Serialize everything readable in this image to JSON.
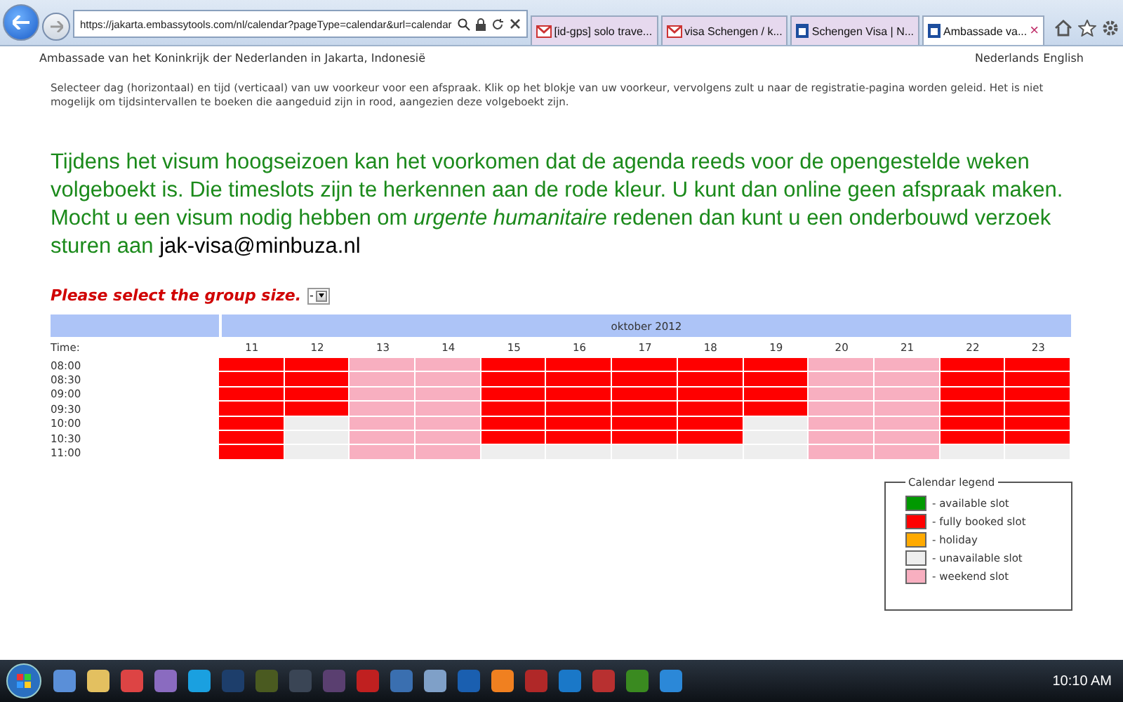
{
  "browser": {
    "address": "https://jakarta.embassytools.com/nl/calendar?pageType=calendar&url=calendar",
    "tabs": [
      {
        "title": "[id-gps] solo trave...",
        "kind": "mail",
        "selected": false
      },
      {
        "title": "visa Schengen / k...",
        "kind": "mail",
        "selected": false
      },
      {
        "title": "Schengen Visa | N...",
        "kind": "site",
        "selected": false
      },
      {
        "title": "Ambassade va...",
        "kind": "site",
        "selected": true,
        "close": "×"
      }
    ]
  },
  "header": {
    "title": "Ambassade van het Koninkrijk der Nederlanden in Jakarta, Indonesië",
    "languages": [
      "Nederlands",
      "English"
    ]
  },
  "instructions": "Selecteer dag (horizontaal) en tijd (verticaal) van uw voorkeur voor een afspraak. Klik op het blokje van uw voorkeur, vervolgens zult u naar de registratie-pagina worden geleid. Het is niet mogelijk om tijdsintervallen te boeken die aangeduid zijn in rood, aangezien deze volgeboekt zijn.",
  "notice": "Tijdens het visum hoogseizoen kan het voorkomen dat de agenda reeds voor de opengestelde weken volgeboekt is. Die timeslots zijn te herkennen aan de rode kleur. U kunt dan online geen afspraak maken. Mocht u een visum nodig hebben om *urgente humanitaire* redenen dan kunt u een onderbouwd verzoek sturen aan ",
  "notice_email": "jak-visa@minbuza.nl",
  "group_size": {
    "label": "Please select the group size.",
    "value": "-"
  },
  "calendar": {
    "month": "oktober 2012",
    "time_label": "Time:",
    "times": [
      "08:00",
      "08:30",
      "09:00",
      "09:30",
      "10:00",
      "10:30",
      "11:00"
    ],
    "days": [
      {
        "day": "11",
        "slots": [
          {
            "kind": "booked"
          },
          {
            "kind": "booked"
          },
          {
            "kind": "booked"
          },
          {
            "kind": "booked"
          },
          {
            "kind": "booked"
          },
          {
            "kind": "booked"
          },
          {
            "kind": "booked"
          }
        ]
      },
      {
        "day": "12",
        "slots": [
          {
            "kind": "booked"
          },
          {
            "kind": "booked"
          },
          {
            "kind": "booked"
          },
          {
            "kind": "booked"
          },
          {
            "kind": "unavailable"
          },
          {
            "kind": "unavailable"
          },
          {
            "kind": "unavailable"
          }
        ]
      },
      {
        "day": "13",
        "slots": [
          {
            "kind": "weekend"
          },
          {
            "kind": "weekend"
          },
          {
            "kind": "weekend"
          },
          {
            "kind": "weekend"
          },
          {
            "kind": "weekend"
          },
          {
            "kind": "weekend"
          },
          {
            "kind": "weekend"
          }
        ]
      },
      {
        "day": "14",
        "slots": [
          {
            "kind": "weekend"
          },
          {
            "kind": "weekend"
          },
          {
            "kind": "weekend"
          },
          {
            "kind": "weekend"
          },
          {
            "kind": "weekend"
          },
          {
            "kind": "weekend"
          },
          {
            "kind": "weekend"
          }
        ]
      },
      {
        "day": "15",
        "slots": [
          {
            "kind": "booked"
          },
          {
            "kind": "booked"
          },
          {
            "kind": "booked"
          },
          {
            "kind": "booked"
          },
          {
            "kind": "booked"
          },
          {
            "kind": "booked"
          },
          {
            "kind": "unavailable"
          }
        ]
      },
      {
        "day": "16",
        "slots": [
          {
            "kind": "booked"
          },
          {
            "kind": "booked"
          },
          {
            "kind": "booked"
          },
          {
            "kind": "booked"
          },
          {
            "kind": "booked"
          },
          {
            "kind": "booked"
          },
          {
            "kind": "unavailable"
          }
        ]
      },
      {
        "day": "17",
        "slots": [
          {
            "kind": "booked"
          },
          {
            "kind": "booked"
          },
          {
            "kind": "booked"
          },
          {
            "kind": "booked"
          },
          {
            "kind": "booked"
          },
          {
            "kind": "booked"
          },
          {
            "kind": "unavailable"
          }
        ]
      },
      {
        "day": "18",
        "slots": [
          {
            "kind": "booked"
          },
          {
            "kind": "booked"
          },
          {
            "kind": "booked"
          },
          {
            "kind": "booked"
          },
          {
            "kind": "booked"
          },
          {
            "kind": "booked"
          },
          {
            "kind": "unavailable"
          }
        ]
      },
      {
        "day": "19",
        "slots": [
          {
            "kind": "booked"
          },
          {
            "kind": "booked"
          },
          {
            "kind": "booked"
          },
          {
            "kind": "booked"
          },
          {
            "kind": "unavailable"
          },
          {
            "kind": "unavailable"
          },
          {
            "kind": "unavailable"
          }
        ]
      },
      {
        "day": "20",
        "slots": [
          {
            "kind": "weekend"
          },
          {
            "kind": "weekend"
          },
          {
            "kind": "weekend"
          },
          {
            "kind": "weekend"
          },
          {
            "kind": "weekend"
          },
          {
            "kind": "weekend"
          },
          {
            "kind": "weekend"
          }
        ]
      },
      {
        "day": "21",
        "slots": [
          {
            "kind": "weekend"
          },
          {
            "kind": "weekend"
          },
          {
            "kind": "weekend"
          },
          {
            "kind": "weekend"
          },
          {
            "kind": "weekend"
          },
          {
            "kind": "weekend"
          },
          {
            "kind": "weekend"
          }
        ]
      },
      {
        "day": "22",
        "slots": [
          {
            "kind": "booked"
          },
          {
            "kind": "booked"
          },
          {
            "kind": "booked"
          },
          {
            "kind": "booked"
          },
          {
            "kind": "booked"
          },
          {
            "kind": "booked"
          },
          {
            "kind": "unavailable"
          }
        ]
      },
      {
        "day": "23",
        "slots": [
          {
            "kind": "booked"
          },
          {
            "kind": "booked"
          },
          {
            "kind": "booked"
          },
          {
            "kind": "booked"
          },
          {
            "kind": "booked"
          },
          {
            "kind": "booked"
          },
          {
            "kind": "unavailable"
          }
        ]
      }
    ]
  },
  "legend": {
    "title": "Calendar legend",
    "items": [
      {
        "kind": "available",
        "label": "- available slot",
        "color": "#009900"
      },
      {
        "kind": "booked",
        "label": "- fully booked slot",
        "color": "#ff0000"
      },
      {
        "kind": "holiday",
        "label": "- holiday",
        "color": "#ffaa00"
      },
      {
        "kind": "unavailable",
        "label": "- unavailable slot",
        "color": "#eeeeee"
      },
      {
        "kind": "weekend",
        "label": "- weekend slot",
        "color": "#f8afc0"
      }
    ]
  },
  "taskbar": {
    "clock": "10:10 AM"
  }
}
